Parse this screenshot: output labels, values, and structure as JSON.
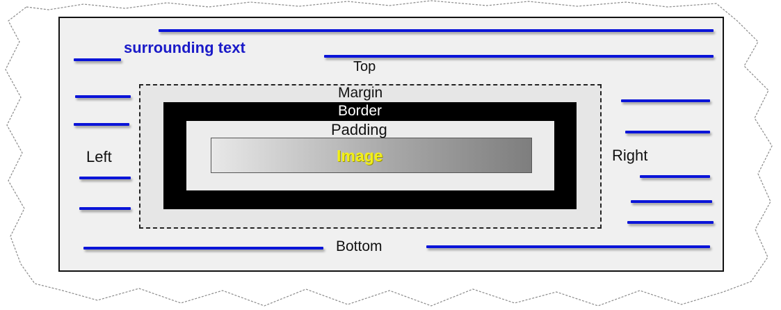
{
  "labels": {
    "surrounding_text": "surrounding text",
    "top": "Top",
    "margin": "Margin",
    "border": "Border",
    "padding": "Padding",
    "image": "Image",
    "left": "Left",
    "right": "Right",
    "bottom": "Bottom"
  },
  "colors": {
    "text_lines": "#0a14d8",
    "surrounding_text": "#1a1ac8",
    "image_label": "#f2ef1a",
    "border_fill": "#000000",
    "frame_background": "#f0f0f0"
  },
  "icons": {
    "decoration": "torn-paper-edge"
  }
}
